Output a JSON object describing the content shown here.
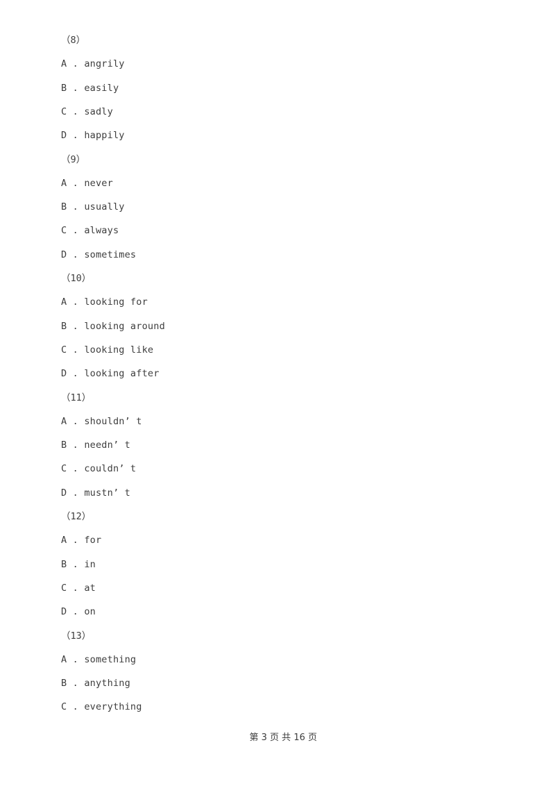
{
  "document": {
    "page_background": "#ffffff",
    "text_color": "#3d3d3d"
  },
  "question_groups": [
    {
      "number_label": "（8）",
      "options": [
        {
          "letter": "A",
          "separator": " . ",
          "text": "angrily"
        },
        {
          "letter": "B",
          "separator": " . ",
          "text": "easily"
        },
        {
          "letter": "C",
          "separator": " . ",
          "text": "sadly"
        },
        {
          "letter": "D",
          "separator": " . ",
          "text": "happily"
        }
      ]
    },
    {
      "number_label": "（9）",
      "options": [
        {
          "letter": "A",
          "separator": " . ",
          "text": "never"
        },
        {
          "letter": "B",
          "separator": " . ",
          "text": "usually"
        },
        {
          "letter": "C",
          "separator": " . ",
          "text": "always"
        },
        {
          "letter": "D",
          "separator": " . ",
          "text": "sometimes"
        }
      ]
    },
    {
      "number_label": "（10）",
      "options": [
        {
          "letter": "A",
          "separator": " . ",
          "text": "looking for"
        },
        {
          "letter": "B",
          "separator": " . ",
          "text": "looking around"
        },
        {
          "letter": "C",
          "separator": " . ",
          "text": "looking like"
        },
        {
          "letter": "D",
          "separator": " . ",
          "text": "looking after"
        }
      ]
    },
    {
      "number_label": "（11）",
      "options": [
        {
          "letter": "A",
          "separator": " . ",
          "text": "shouldn’ t"
        },
        {
          "letter": "B",
          "separator": " . ",
          "text": "needn’ t"
        },
        {
          "letter": "C",
          "separator": " . ",
          "text": "couldn’ t"
        },
        {
          "letter": "D",
          "separator": " . ",
          "text": "mustn’ t"
        }
      ]
    },
    {
      "number_label": "（12）",
      "options": [
        {
          "letter": "A",
          "separator": " . ",
          "text": "for"
        },
        {
          "letter": "B",
          "separator": " . ",
          "text": "in"
        },
        {
          "letter": "C",
          "separator": " . ",
          "text": "at"
        },
        {
          "letter": "D",
          "separator": " . ",
          "text": "on"
        }
      ]
    },
    {
      "number_label": "（13）",
      "options": [
        {
          "letter": "A",
          "separator": " . ",
          "text": "something"
        },
        {
          "letter": "B",
          "separator": " . ",
          "text": "anything"
        },
        {
          "letter": "C",
          "separator": " . ",
          "text": "everything"
        }
      ]
    }
  ],
  "footer": {
    "text": "第 3 页 共 16 页"
  }
}
